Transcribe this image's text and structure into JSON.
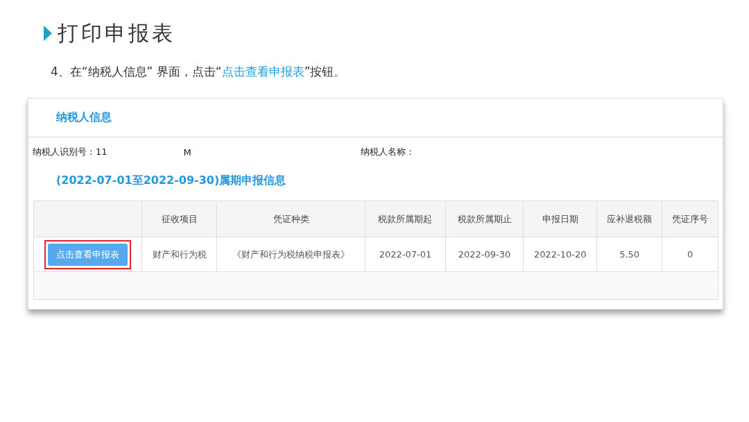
{
  "slide_title": "打印申报表",
  "instruction": {
    "before": "4、在“纳税人信息” 界面，点击“",
    "highlight": "点击查看申报表",
    "after": "”按钮。"
  },
  "panel": {
    "title": "纳税人信息",
    "taxpayer_id_label": "纳税人识别号：11",
    "taxpayer_id_value": "M",
    "taxpayer_name_label": "纳税人名称：",
    "period_title": "(2022-07-01至2022-09-30)属期申报信息",
    "table": {
      "columns": [
        "征收项目",
        "凭证种类",
        "税款所属期起",
        "税款所属期止",
        "申报日期",
        "应补退税额",
        "凭证序号"
      ],
      "rows": [
        {
          "button": {
            "label": "点击查看申报表",
            "highlighted": true
          },
          "cells": [
            "财产和行为税",
            "《财产和行为税纳税申报表》",
            "2022-07-01",
            "2022-09-30",
            "2022-10-20",
            "5.50",
            "0"
          ]
        }
      ]
    }
  }
}
